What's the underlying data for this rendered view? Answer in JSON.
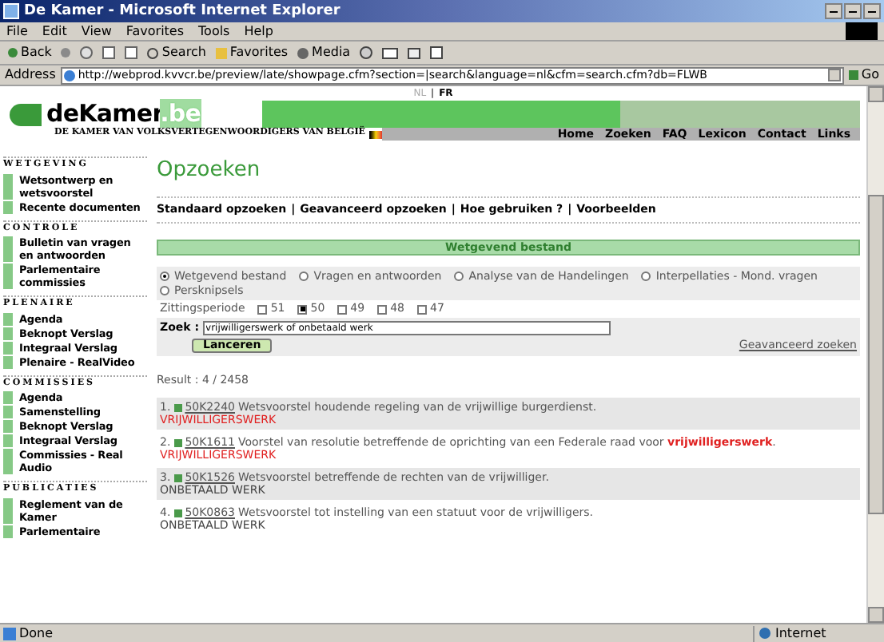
{
  "window": {
    "title": "De Kamer - Microsoft Internet Explorer"
  },
  "menu": [
    "File",
    "Edit",
    "View",
    "Favorites",
    "Tools",
    "Help"
  ],
  "toolbar": {
    "back": "Back",
    "search": "Search",
    "favorites": "Favorites",
    "media": "Media"
  },
  "address": {
    "label": "Address",
    "url": "http://webprod.kvvcr.be/preview/late/showpage.cfm?section=|search&language=nl&cfm=search.cfm?db=FLWB",
    "go": "Go"
  },
  "languages": [
    {
      "label": "NL",
      "selected": true
    },
    {
      "label": "FR",
      "selected": false
    }
  ],
  "language_separator": "|",
  "header": {
    "logo_main": "deKamer",
    "logo_suffix": ".be",
    "subtitle": "DE KAMER VAN VOLKSVERTEGENWOORDIGERS VAN BELGIË",
    "nav": [
      "Home",
      "Zoeken",
      "FAQ",
      "Lexicon",
      "Contact",
      "Links"
    ]
  },
  "sidebar": [
    {
      "heading": "WETGEVING",
      "items": [
        "Wetsontwerp en wetsvoorstel",
        "Recente documenten"
      ]
    },
    {
      "heading": "CONTROLE",
      "items": [
        "Bulletin van vragen en antwoorden",
        "Parlementaire commissies"
      ]
    },
    {
      "heading": "PLENAIRE",
      "items": [
        "Agenda",
        "Beknopt Verslag",
        "Integraal Verslag",
        "Plenaire - RealVideo"
      ]
    },
    {
      "heading": "COMMISSIES",
      "items": [
        "Agenda",
        "Samenstelling",
        "Beknopt Verslag",
        "Integraal Verslag",
        "Commissies - Real Audio"
      ]
    },
    {
      "heading": "PUBLICATIES",
      "items": [
        "Reglement van de Kamer",
        "Parlementaire"
      ]
    }
  ],
  "main": {
    "title": "Opzoeken",
    "tabs": [
      "Standaard opzoeken",
      "Geavanceerd opzoeken",
      "Hoe gebruiken ?",
      "Voorbeelden"
    ],
    "tab_separator": "|",
    "section_banner": "Wetgevend bestand",
    "databases": [
      {
        "label": "Wetgevend bestand",
        "selected": true
      },
      {
        "label": "Vragen en antwoorden",
        "selected": false
      },
      {
        "label": "Analyse van de Handelingen",
        "selected": false
      },
      {
        "label": "Interpellaties - Mond. vragen",
        "selected": false
      },
      {
        "label": "Persknipsels",
        "selected": false
      }
    ],
    "period_label": "Zittingsperiode",
    "periods": [
      {
        "label": "51",
        "checked": false
      },
      {
        "label": "50",
        "checked": true
      },
      {
        "label": "49",
        "checked": false
      },
      {
        "label": "48",
        "checked": false
      },
      {
        "label": "47",
        "checked": false
      }
    ],
    "search_label": "Zoek :",
    "search_value": "vrijwilligerswerk of onbetaald werk",
    "submit": "Lanceren",
    "advanced_link": "Geavanceerd zoeken",
    "result_count": "Result : 4 / 2458",
    "results": [
      {
        "number": "1.",
        "id": "50K2240",
        "title": "Wetsvoorstel houdende regeling van de vrijwillige burgerdienst.",
        "keyword": "VRIJWILLIGERSWERK",
        "keyword_highlight": true
      },
      {
        "number": "2.",
        "id": "50K1611",
        "title": "Voorstel van resolutie betreffende de oprichting van een Federale raad voor **vrijwilligerswerk**.",
        "keyword": "VRIJWILLIGERSWERK",
        "keyword_highlight": true
      },
      {
        "number": "3.",
        "id": "50K1526",
        "title": "Wetsvoorstel betreffende de rechten van de vrijwilliger.",
        "keyword": "ONBETAALD WERK",
        "keyword_highlight": false
      },
      {
        "number": "4.",
        "id": "50K0863",
        "title": "Wetsvoorstel tot instelling van een statuut voor de vrijwilligers.",
        "keyword": "ONBETAALD WERK",
        "keyword_highlight": false
      }
    ]
  },
  "status_bar": {
    "text": "Done",
    "zone": "Internet"
  }
}
